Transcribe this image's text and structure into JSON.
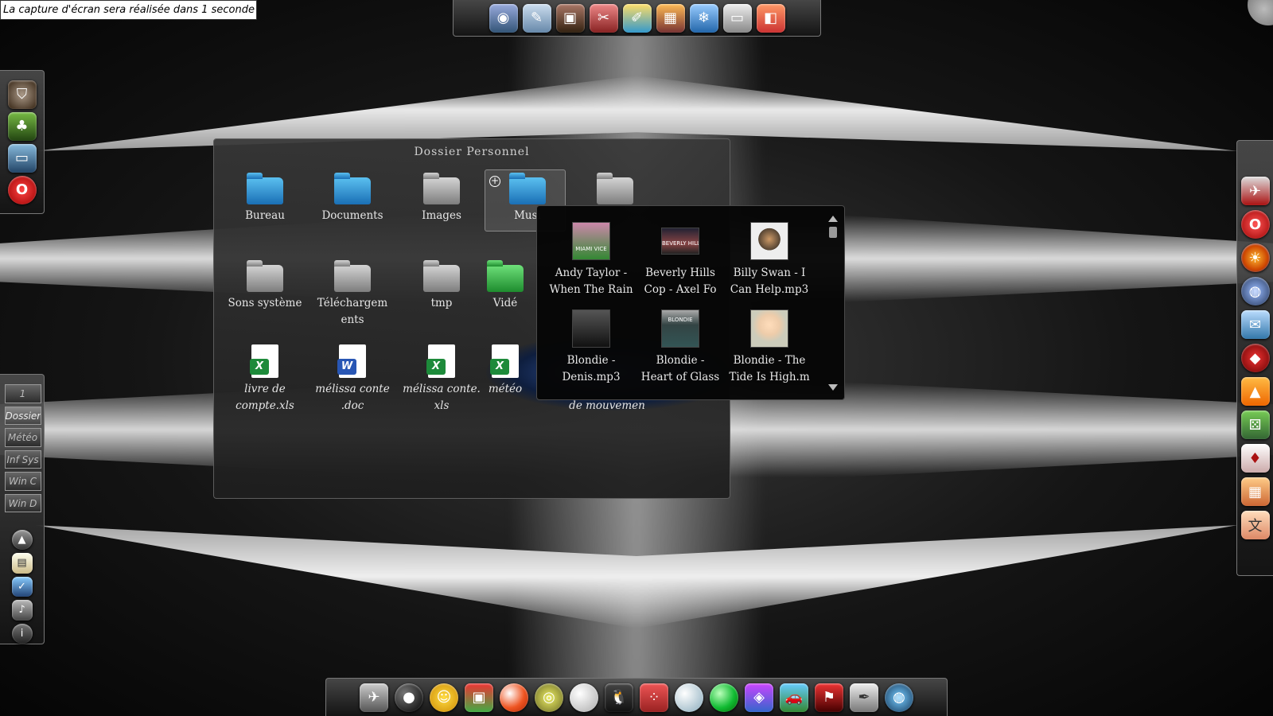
{
  "notice": "La capture d'écran sera réalisée dans 1 seconde",
  "folder_window": {
    "title": "Dossier Personnel",
    "items": [
      {
        "label": "Bureau",
        "icon": "folder-desktop-icon"
      },
      {
        "label": "Documents",
        "icon": "folder-documents-icon"
      },
      {
        "label": "Images",
        "icon": "folder-images-icon"
      },
      {
        "label": "Musi",
        "icon": "folder-music-icon"
      },
      {
        "label": "",
        "icon": "folder-icon"
      },
      {
        "label": "Sons système",
        "icon": "folder-system-sounds-icon"
      },
      {
        "label": "Téléchargements",
        "icon": "folder-downloads-icon"
      },
      {
        "label": "tmp",
        "icon": "folder-tmp-icon"
      },
      {
        "label": "Vidé",
        "icon": "folder-videos-icon"
      },
      {
        "label": "livre de compte.xls",
        "icon": "spreadsheet-file-icon"
      },
      {
        "label": "mélissa conte .doc",
        "icon": "word-document-icon"
      },
      {
        "label": "mélissa conte. xls",
        "icon": "spreadsheet-file-icon"
      },
      {
        "label": "météo",
        "icon": "spreadsheet-file-icon"
      },
      {
        "label": "de mouvemen",
        "icon": "file-icon"
      }
    ]
  },
  "music_popup": {
    "tracks": [
      {
        "line1": "Andy Taylor -",
        "line2": "When The Rain",
        "cover_text": "MIAMI VICE"
      },
      {
        "line1": "Beverly Hills",
        "line2": "Cop - Axel Fo",
        "cover_text": "BEVERLY HILLS"
      },
      {
        "line1": "Billy Swan - I",
        "line2": "Can Help.mp3",
        "cover_text": ""
      },
      {
        "line1": "Blondie -",
        "line2": "Denis.mp3",
        "cover_text": ""
      },
      {
        "line1": "Blondie -",
        "line2": "Heart of Glass",
        "cover_text": "BLONDIE"
      },
      {
        "line1": "Blondie - The",
        "line2": "Tide Is High.m",
        "cover_text": ""
      }
    ]
  },
  "workspaces": {
    "number": "1",
    "items": [
      "Dossier",
      "Météo",
      "Inf Sys",
      "Win C",
      "Win D"
    ],
    "active_index": 0
  },
  "docks": {
    "top": [
      "camera-icon",
      "pencil-edit-icon",
      "photo-camera-icon",
      "tools-icon",
      "paint-icon",
      "image-viewer-icon",
      "snowflake-icon",
      "scanner-icon",
      "presentation-icon"
    ],
    "left": [
      "shield-icon",
      "tree-icon",
      "monitor-icon",
      "opera-icon"
    ],
    "left_bottom": [
      "arrow-up-icon",
      "clipboard-icon",
      "screen-check-icon",
      "speaker-icon",
      "info-icon"
    ],
    "right": [
      "eagle-icon",
      "opera-icon",
      "firefox-icon",
      "globe-icon",
      "mail-icon",
      "red-app-icon",
      "vlc-icon",
      "dice-icon",
      "cards-icon",
      "mahjong-icon",
      "dictionary-icon"
    ],
    "bottom": [
      "spaceship-icon",
      "bomb-icon",
      "chick-icon",
      "puzzle-icon",
      "ball-icon",
      "ring-icon",
      "golf-icon",
      "tux-icon",
      "dots-game-icon",
      "sphere-icon",
      "green-orb-icon",
      "cube-game-icon",
      "racing-car-icon",
      "kart-icon",
      "pen-icon",
      "earth-icon"
    ]
  },
  "colors": {
    "panel_bg": "#2d2d2d",
    "popup_bg": "#060606",
    "xls_green": "#1d8a3a",
    "doc_blue": "#2856b4"
  }
}
